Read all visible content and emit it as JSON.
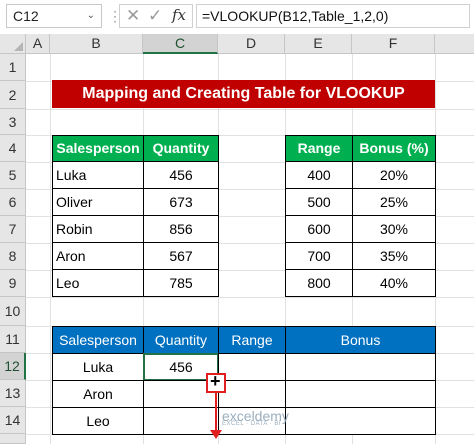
{
  "formula_bar": {
    "name_box": "C12",
    "name_box_arrow": "⌄",
    "separator": "⋮",
    "cancel_symbol": "✕",
    "enter_symbol": "✓",
    "fx_symbol": "fx",
    "formula": "=VLOOKUP(B12,Table_1,2,0)"
  },
  "columns": [
    "A",
    "B",
    "C",
    "D",
    "E",
    "F"
  ],
  "rows": [
    "1",
    "2",
    "3",
    "4",
    "5",
    "6",
    "7",
    "8",
    "9",
    "10",
    "11",
    "12",
    "13",
    "14"
  ],
  "title": "Mapping and Creating Table for VLOOKUP",
  "table1": {
    "headers": [
      "Salesperson",
      "Quantity"
    ],
    "rows": [
      [
        "Luka",
        "456"
      ],
      [
        "Oliver",
        "673"
      ],
      [
        "Robin",
        "856"
      ],
      [
        "Aron",
        "567"
      ],
      [
        "Leo",
        "785"
      ]
    ]
  },
  "table2": {
    "headers": [
      "Range",
      "Bonus (%)"
    ],
    "rows": [
      [
        "400",
        "20%"
      ],
      [
        "500",
        "25%"
      ],
      [
        "600",
        "30%"
      ],
      [
        "700",
        "35%"
      ],
      [
        "800",
        "40%"
      ]
    ]
  },
  "table3": {
    "headers": [
      "Salesperson",
      "Quantity",
      "Range",
      "Bonus"
    ],
    "rows": [
      [
        "Luka",
        "456",
        "",
        ""
      ],
      [
        "Aron",
        "",
        "",
        ""
      ],
      [
        "Leo",
        "",
        "",
        ""
      ]
    ]
  },
  "watermark": {
    "name": "exceldemy",
    "tagline": "EXCEL · DATA · BI"
  },
  "colors": {
    "title_bg": "#c00000",
    "green_header": "#00b050",
    "blue_header": "#0070c0",
    "selection": "#217346",
    "arrow": "#e02020"
  }
}
